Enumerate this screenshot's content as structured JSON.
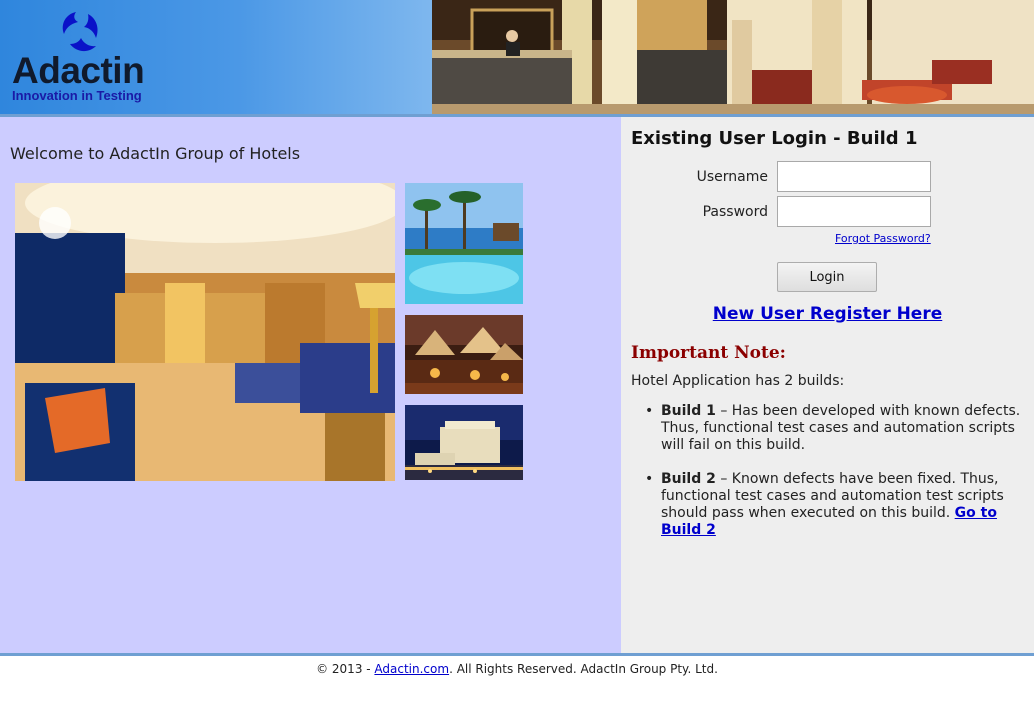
{
  "header": {
    "logo_word": "Adactin",
    "logo_tagline": "Innovation in Testing",
    "logo_alt": "Adactin logo",
    "lobby_alt": "Hotel lobby"
  },
  "main": {
    "welcome": "Welcome to AdactIn Group of Hotels",
    "images": {
      "main_alt": "Luxury hotel suite",
      "pool_alt": "Resort pool with palm trees",
      "tents_alt": "Outdoor restaurant tents",
      "night_alt": "Hotel building at night"
    }
  },
  "login": {
    "title": "Existing User Login - Build 1",
    "username_label": "Username",
    "username_value": "",
    "password_label": "Password",
    "password_value": "",
    "forgot_label": "Forgot Password?",
    "login_label": "Login",
    "register_label": "New User Register Here"
  },
  "note": {
    "title": "Important Note:",
    "intro": "Hotel Application has 2 builds:",
    "builds": [
      {
        "name": "Build 1",
        "text": " – Has been developed with known defects. Thus, functional test cases and automation scripts will fail on this build."
      },
      {
        "name": "Build 2",
        "text": " – Known defects have been fixed. Thus, functional test cases and automation test scripts should pass when executed on this build. ",
        "link": "Go to Build 2"
      }
    ]
  },
  "footer": {
    "prefix": "© 2013 - ",
    "link": "Adactin.com",
    "suffix": ". All Rights Reserved. AdactIn Group Pty. Ltd."
  },
  "colors": {
    "header_blue": "#2f86dd",
    "left_panel_bg": "#ccccff",
    "right_panel_bg": "#eeeeee",
    "link_blue": "#0000cc",
    "note_red": "#8b0000",
    "divider_blue": "#6f9fd2"
  }
}
